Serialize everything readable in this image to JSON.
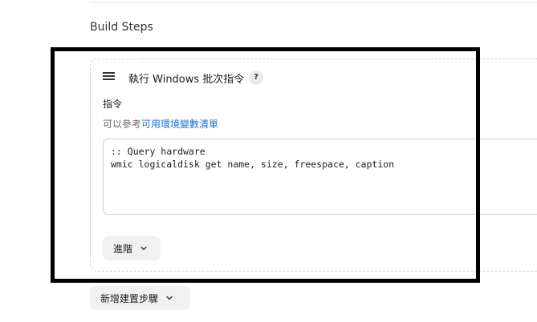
{
  "section": {
    "title": "Build Steps"
  },
  "step": {
    "title": "執行 Windows 批次指令",
    "help_label": "?",
    "field_label": "指令",
    "hint_prefix": "可以參考",
    "hint_link": "可用環境變數清單",
    "command": ":: Query hardware\nwmic logicaldisk get name, size, freespace, caption",
    "advanced_label": "進階"
  },
  "footer": {
    "add_step_label": "新增建置步驟"
  },
  "icons": {
    "drag": "drag-handle-icon",
    "help": "question-mark-icon",
    "chevron": "chevron-down-icon"
  },
  "colors": {
    "link": "#1f6fd1",
    "button_bg": "#f1f1f1",
    "highlight_frame": "#000000"
  }
}
